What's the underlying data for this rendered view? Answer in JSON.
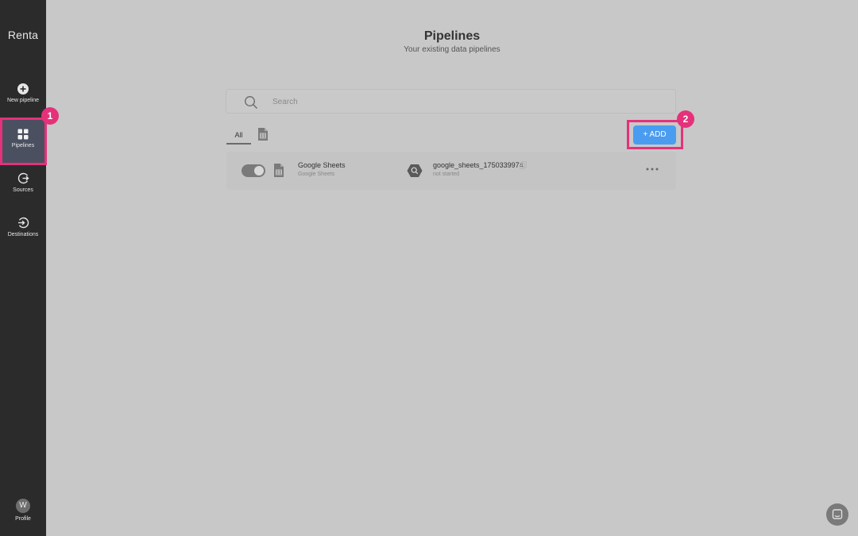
{
  "app": {
    "brand": "Renta"
  },
  "sidebar": {
    "items": [
      {
        "label": "New pipeline",
        "icon": "plus-circle-icon"
      },
      {
        "label": "Pipelines",
        "icon": "grid-icon",
        "active": true
      },
      {
        "label": "Sources",
        "icon": "source-icon"
      },
      {
        "label": "Destinations",
        "icon": "destination-icon"
      }
    ],
    "profile": {
      "label": "Profile",
      "initial": "W"
    }
  },
  "header": {
    "title": "Pipelines",
    "subtitle": "Your existing data pipelines"
  },
  "search": {
    "placeholder": "Search",
    "value": ""
  },
  "tabs": [
    {
      "label": "All",
      "active": true
    },
    {
      "label": "",
      "icon": "google-sheets-icon"
    }
  ],
  "add_button": {
    "label": "+ ADD"
  },
  "pipelines": [
    {
      "enabled": true,
      "source_name": "Google Sheets",
      "source_type": "Google Sheets",
      "destination_name": "google_sheets_1750339974",
      "status": "not started"
    }
  ],
  "annotations": [
    {
      "number": "1"
    },
    {
      "number": "2"
    }
  ],
  "colors": {
    "sidebar_bg": "#2b2b2b",
    "active_nav_bg": "#4a5060",
    "accent": "#4a9cf0",
    "annotation": "#e5317a",
    "page_bg": "#c8c8c8"
  }
}
